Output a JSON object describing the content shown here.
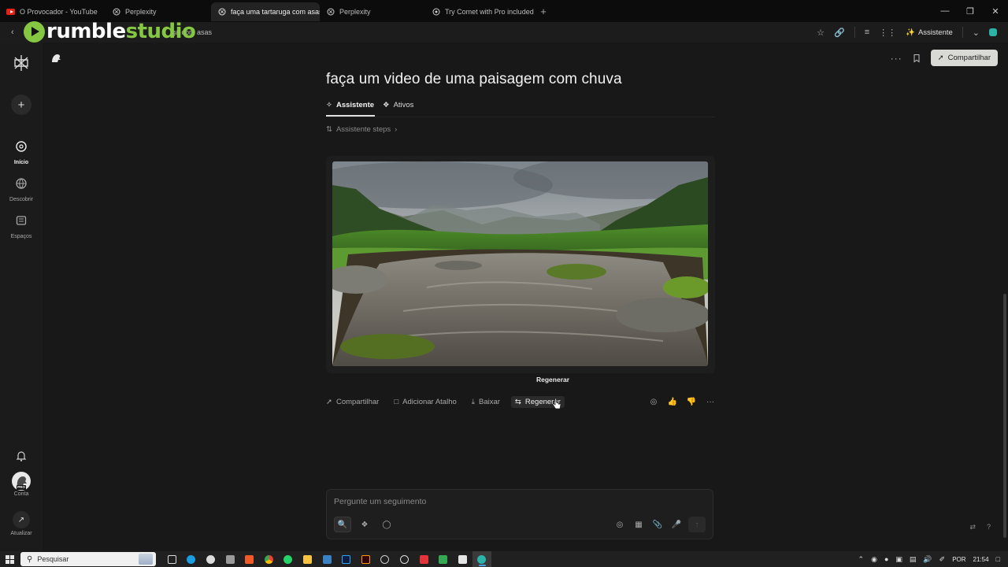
{
  "browser": {
    "tabs": [
      {
        "title": "O Provocador - YouTube",
        "icon": "youtube-icon",
        "active": false
      },
      {
        "title": "Perplexity",
        "icon": "perplexity-icon",
        "active": false
      },
      {
        "title": "faça uma tartaruga com asas",
        "icon": "perplexity-icon",
        "active": true
      },
      {
        "title": "Perplexity",
        "icon": "perplexity-icon",
        "active": false
      },
      {
        "title": "Try Comet with Pro included",
        "icon": "comet-icon",
        "active": false
      }
    ],
    "new_tab_symbol": "+",
    "address_fragment": "ga com asas",
    "assistant_label": "Assistente"
  },
  "watermark": {
    "rumble_white": "rumble",
    "rumble_green": "studio"
  },
  "sidebar": {
    "items": [
      {
        "label": "Início",
        "icon": "home-search-icon",
        "active": true
      },
      {
        "label": "Descobrir",
        "icon": "discover-globe-icon",
        "active": false
      },
      {
        "label": "Espaços",
        "icon": "spaces-icon",
        "active": false
      }
    ],
    "account_label": "Conta",
    "pro_badge": "PRO",
    "update_label": "Atualizar"
  },
  "main": {
    "share_label": "Compartilhar",
    "title": "faça um video de uma paisagem com chuva",
    "tabs": [
      {
        "label": "Assistente",
        "icon": "assistant-icon",
        "active": true
      },
      {
        "label": "Ativos",
        "icon": "assets-icon",
        "active": false
      }
    ],
    "steps_label": "Assistente steps",
    "tooltip": "Regenerar",
    "actions": [
      {
        "label": "Compartilhar",
        "icon": "share-icon"
      },
      {
        "label": "Adicionar Atalho",
        "icon": "shortcut-icon"
      },
      {
        "label": "Baixar",
        "icon": "download-icon"
      },
      {
        "label": "Regenerar",
        "icon": "regenerate-icon"
      }
    ],
    "input": {
      "placeholder": "Pergunte um seguimento"
    }
  },
  "taskbar": {
    "search_placeholder": "Pesquisar",
    "language": "POR",
    "time": "21:54"
  },
  "colors": {
    "background": "#181818",
    "sidebar": "#1b1b1b",
    "accent_rumble": "#85c742",
    "share_button": "#d9d9d6",
    "youtube_red": "#e62117"
  }
}
